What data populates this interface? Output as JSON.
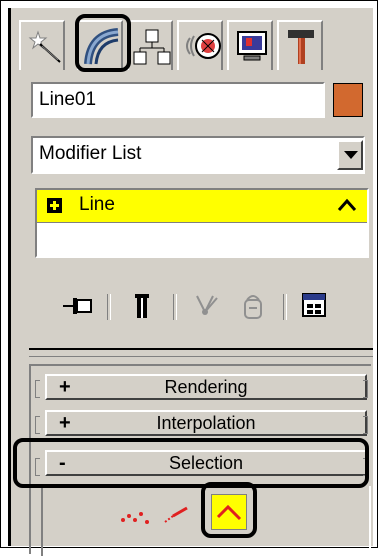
{
  "tabs": [
    {
      "name": "create",
      "icon": "create-star-icon"
    },
    {
      "name": "modify",
      "icon": "modify-arc-icon"
    },
    {
      "name": "hierarchy",
      "icon": "hierarchy-icon"
    },
    {
      "name": "motion",
      "icon": "motion-wheel-icon"
    },
    {
      "name": "display",
      "icon": "display-monitor-icon"
    },
    {
      "name": "utilities",
      "icon": "utilities-hammer-icon"
    }
  ],
  "object": {
    "name": "Line01",
    "color": "#d2692f"
  },
  "modifier_list": {
    "label": "Modifier List"
  },
  "stack": {
    "item_label": "Line"
  },
  "rollouts": {
    "rendering": {
      "sign": "+",
      "title": "Rendering"
    },
    "interpolation": {
      "sign": "+",
      "title": "Interpolation"
    },
    "selection": {
      "sign": "-",
      "title": "Selection"
    }
  },
  "colors": {
    "panel": "#d4d0c8",
    "highlight": "#ffff00",
    "accent_red": "#ff0000"
  }
}
